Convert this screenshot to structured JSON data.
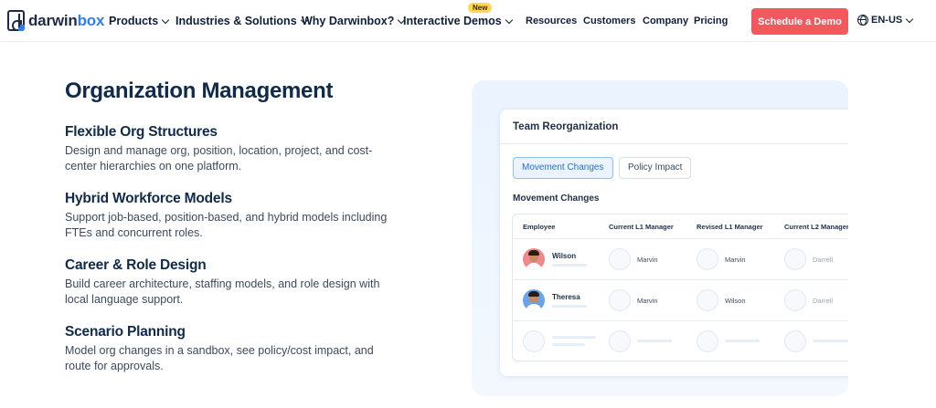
{
  "nav": {
    "logo_prefix": "darwin",
    "logo_suffix": "box",
    "items": [
      "Products",
      "Industries & Solutions",
      "Why Darwinbox?",
      "Interactive Demos"
    ],
    "new_badge": "New",
    "links": [
      "Resources",
      "Customers",
      "Company",
      "Pricing"
    ],
    "cta": "Schedule a Demo",
    "language": "EN-US"
  },
  "main": {
    "title": "Organization Management",
    "features": [
      {
        "title": "Flexible Org Structures",
        "desc": "Design and manage org, position, location, project, and cost-center hierarchies on one platform."
      },
      {
        "title": "Hybrid Workforce Models",
        "desc": "Support job-based, position-based, and hybrid models including FTEs and concurrent roles."
      },
      {
        "title": "Career & Role Design",
        "desc": "Build career architecture, staffing models, and role design with local language support."
      },
      {
        "title": "Scenario Planning",
        "desc": "Model org changes in a sandbox, see policy/cost impact, and route for approvals."
      }
    ]
  },
  "card": {
    "title": "Team Reorganization",
    "tabs": [
      "Movement Changes",
      "Policy Impact"
    ],
    "section_title": "Movement Changes",
    "columns": [
      "Employee",
      "Current L1 Manager",
      "Revised L1 Manager",
      "Current L2 Manager"
    ],
    "rows": [
      {
        "employee": "Wilson",
        "current_l1": "Marvin",
        "revised_l1": "Marvin",
        "current_l2": "Darrell"
      },
      {
        "employee": "Theresa",
        "current_l1": "Marvin",
        "revised_l1": "Wilson",
        "current_l2": "Darrell"
      }
    ]
  },
  "colors": {
    "cta": "#f2595f",
    "brand_blue": "#2f7df6",
    "heading": "#0f2a4a",
    "badge": "#ffd84d",
    "tab_active": "#2a6fd1"
  },
  "icons": [
    "logo-icon",
    "chevron-down-icon",
    "globe-icon"
  ]
}
